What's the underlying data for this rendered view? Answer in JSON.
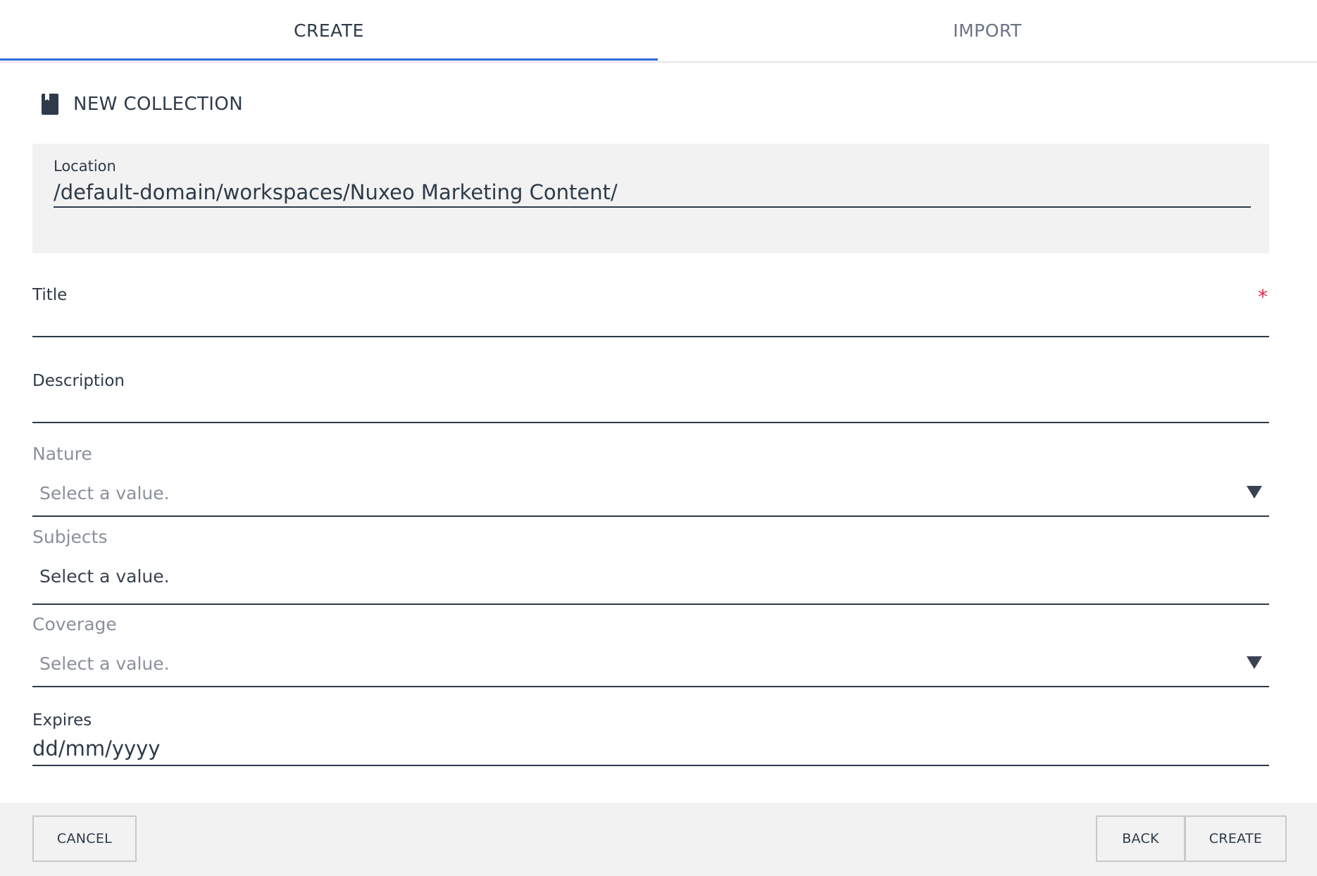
{
  "tabs": [
    {
      "label": "CREATE",
      "active": true
    },
    {
      "label": "IMPORT",
      "active": false
    }
  ],
  "header": {
    "title": "NEW COLLECTION",
    "icon": "collection-book-icon"
  },
  "location": {
    "label": "Location",
    "value": "/default-domain/workspaces/Nuxeo Marketing Content/"
  },
  "fields": {
    "title": {
      "label": "Title",
      "required_mark": "*",
      "value": ""
    },
    "description": {
      "label": "Description",
      "value": ""
    },
    "nature": {
      "label": "Nature",
      "placeholder": "Select a value."
    },
    "subjects": {
      "label": "Subjects",
      "placeholder": "Select a value."
    },
    "coverage": {
      "label": "Coverage",
      "placeholder": "Select a value."
    },
    "expires": {
      "label": "Expires",
      "placeholder": "dd/mm/yyyy"
    }
  },
  "footer": {
    "cancel_label": "CANCEL",
    "back_label": "BACK",
    "create_label": "CREATE"
  },
  "colors": {
    "accent": "#2e6bd8",
    "required": "#e0294b",
    "text": "#2e3a49",
    "panel": "#f2f2f2"
  }
}
